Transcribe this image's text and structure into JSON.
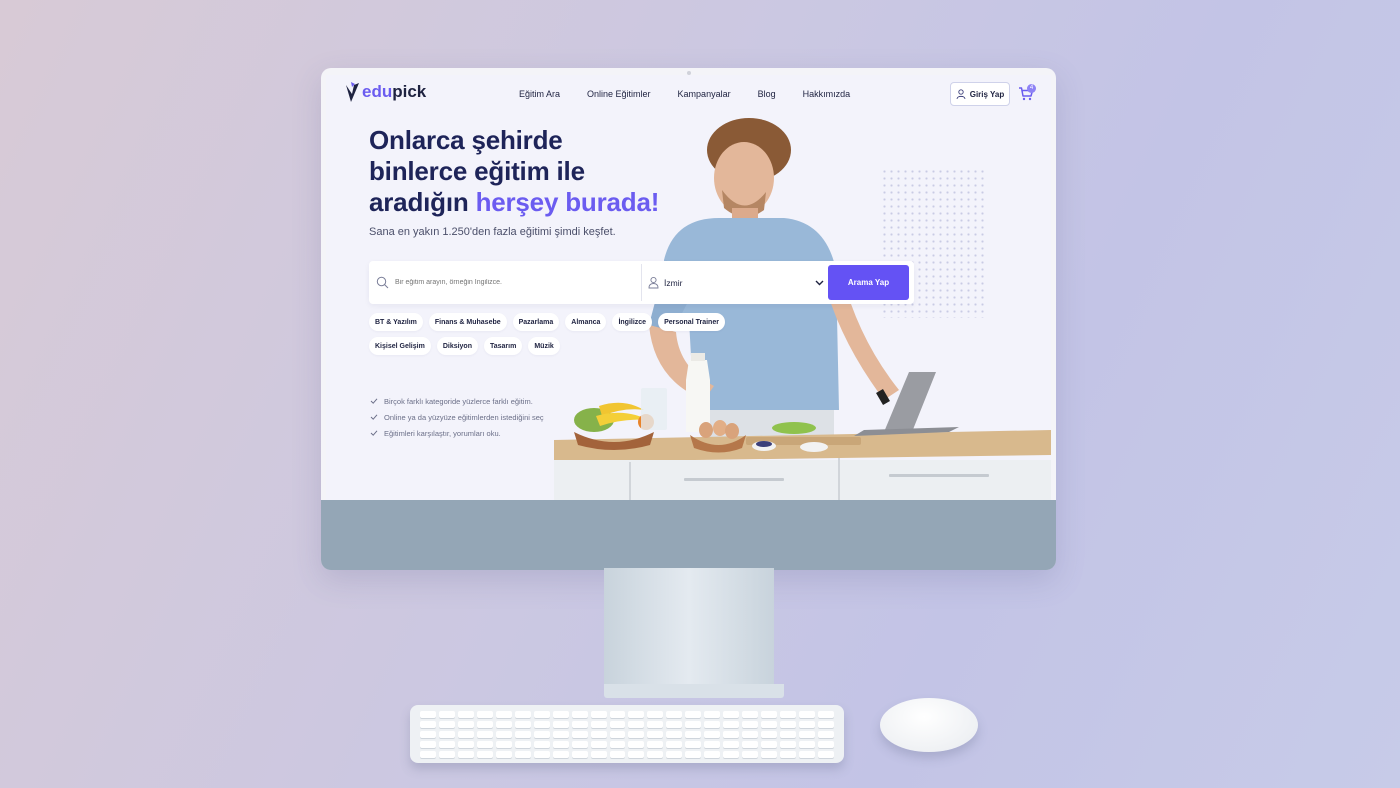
{
  "site": {
    "logo": {
      "part1": "edu",
      "part2": "pick"
    },
    "nav": {
      "links": [
        "Eğitim Ara",
        "Online Eğitimler",
        "Kampanyalar",
        "Blog",
        "Hakkımızda"
      ],
      "login_label": "Giriş Yap",
      "cart_count": "4"
    },
    "hero": {
      "title_line1": "Onlarca şehirde",
      "title_line2": "binlerce eğitim ile",
      "title_line3_start": "aradığın",
      "title_line3_accent": "herşey burada!",
      "subtitle": "Sana en yakın 1.250'den fazla eğitimi şimdi keşfet."
    },
    "search": {
      "placeholder": "Bir eğitim arayın, örneğin İngilizce.",
      "location": "İzmir",
      "button_label": "Arama Yap"
    },
    "categories": [
      "BT & Yazılım",
      "Finans & Muhasebe",
      "Pazarlama",
      "Almanca",
      "İngilizce",
      "Personal Trainer",
      "Kişisel Gelişim",
      "Diksiyon",
      "Tasarım",
      "Müzik"
    ],
    "features": [
      "Birçok farklı kategoride yüzlerce farklı eğitim.",
      "Online ya da yüzyüze eğitimlerden istediğini seç",
      "Eğitimleri karşılaştır, yorumları oku."
    ],
    "colors": {
      "accent": "#6b5cf0",
      "button": "#6452f4",
      "heading": "#1e2459"
    },
    "icons": [
      "logo-mark-icon",
      "user-icon",
      "cart-icon",
      "search-icon",
      "location-icon",
      "chevron-down-icon",
      "check-icon"
    ]
  }
}
